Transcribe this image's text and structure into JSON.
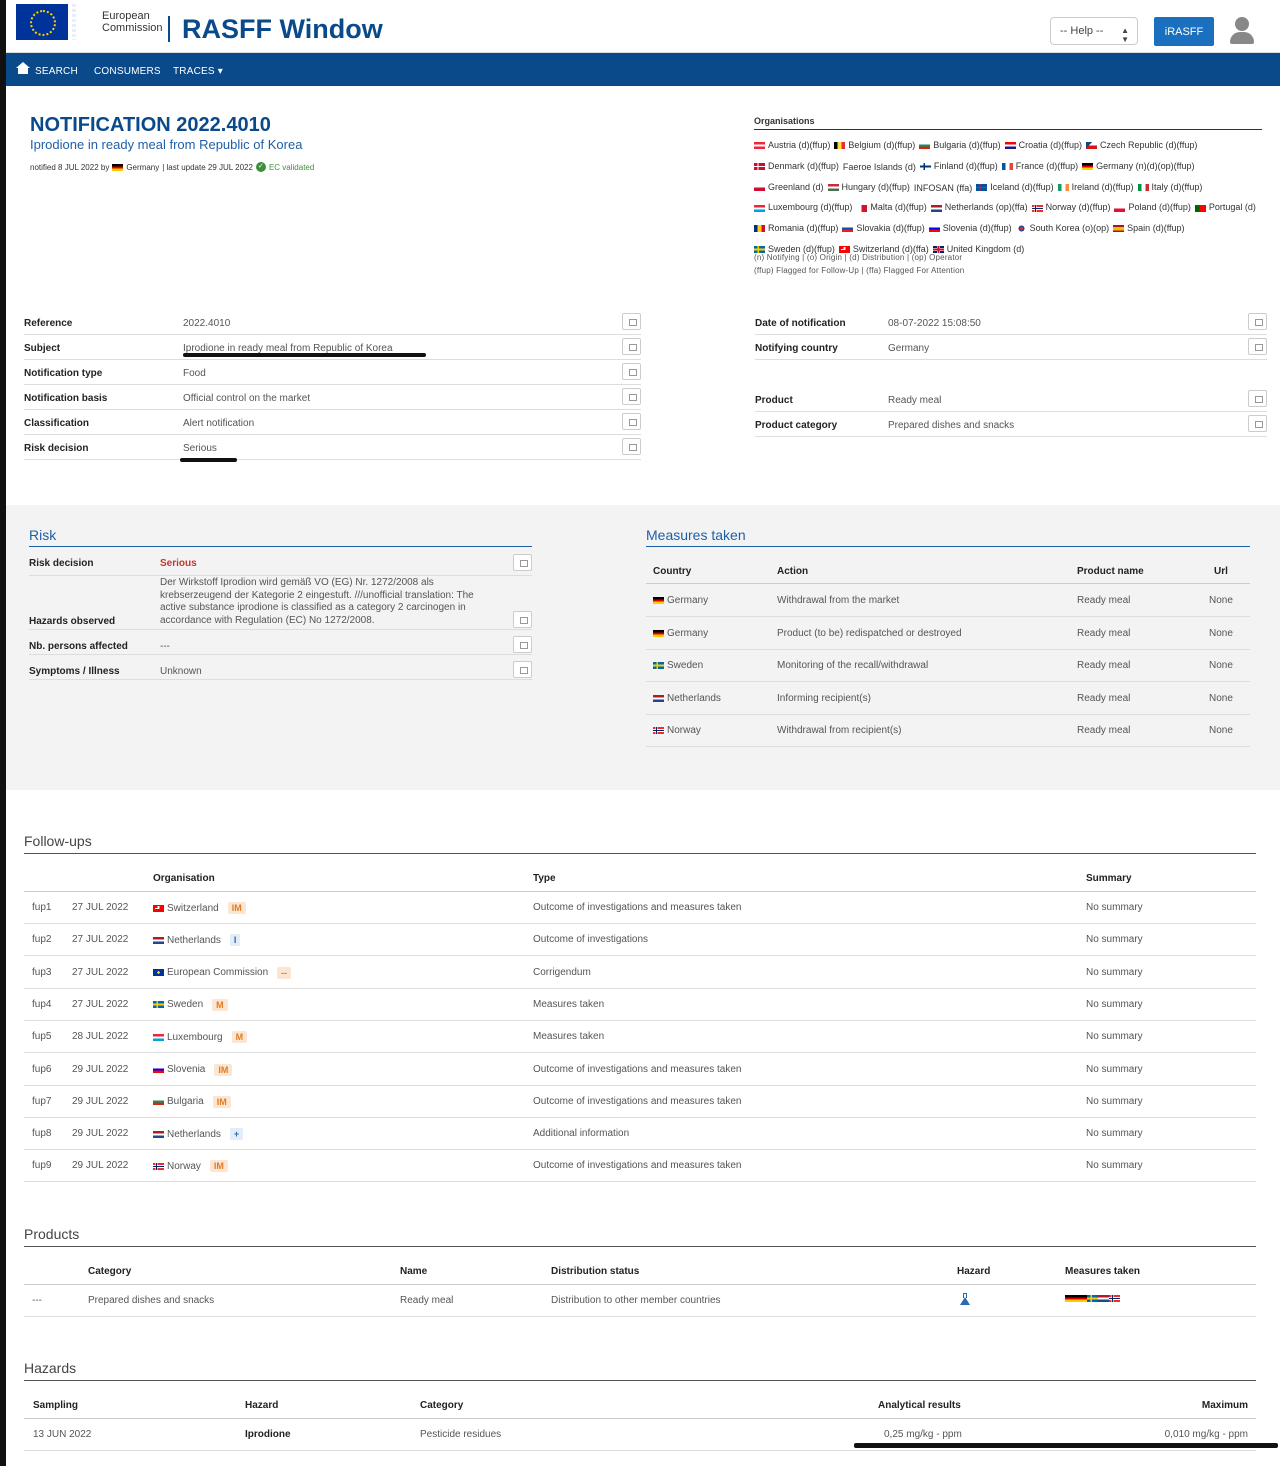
{
  "header": {
    "org_name_line1": "European",
    "org_name_line2": "Commission",
    "app_title": "RASFF Window",
    "help_select": "-- Help --",
    "irasff_button": "iRASFF"
  },
  "nav": {
    "search": "SEARCH",
    "consumers": "CONSUMERS",
    "traces": "TRACES ▾"
  },
  "notification": {
    "title": "NOTIFICATION 2022.4010",
    "subtitle": "Iprodione in ready meal from Republic of Korea",
    "meta_prefix": "notified 8 JUL 2022 by",
    "meta_country": "Germany",
    "meta_update": "| last update 29 JUL 2022",
    "validated": "EC validated"
  },
  "organisations": {
    "title": "Organisations",
    "items": [
      {
        "name": "Austria (d)(ffup)",
        "flag": "at"
      },
      {
        "name": "Belgium (d)(ffup)",
        "flag": "be"
      },
      {
        "name": "Bulgaria (d)(ffup)",
        "flag": "bg"
      },
      {
        "name": "Croatia (d)(ffup)",
        "flag": "hr"
      },
      {
        "name": "Czech Republic (d)(ffup)",
        "flag": "cz"
      },
      {
        "name": "Denmark (d)(ffup)",
        "flag": "dk"
      },
      {
        "name": "Faeroe Islands (d)",
        "flag": ""
      },
      {
        "name": "Finland (d)(ffup)",
        "flag": "fi"
      },
      {
        "name": "France (d)(ffup)",
        "flag": "fr"
      },
      {
        "name": "Germany (n)(d)(op)(ffup)",
        "flag": "de"
      },
      {
        "name": "Greenland (d)",
        "flag": "gl"
      },
      {
        "name": "Hungary (d)(ffup)",
        "flag": "hu"
      },
      {
        "name": "INFOSAN (ffa)",
        "flag": ""
      },
      {
        "name": "Iceland (d)(ffup)",
        "flag": "is"
      },
      {
        "name": "Ireland (d)(ffup)",
        "flag": "ie"
      },
      {
        "name": "Italy (d)(ffup)",
        "flag": "it"
      },
      {
        "name": "Luxembourg (d)(ffup)",
        "flag": "lu"
      },
      {
        "name": "Malta (d)(ffup)",
        "flag": "mt"
      },
      {
        "name": "Netherlands (op)(ffa)",
        "flag": "nl"
      },
      {
        "name": "Norway (d)(ffup)",
        "flag": "no"
      },
      {
        "name": "Poland (d)(ffup)",
        "flag": "pl"
      },
      {
        "name": "Portugal (d)",
        "flag": "pt"
      },
      {
        "name": "Romania (d)(ffup)",
        "flag": "ro"
      },
      {
        "name": "Slovakia (d)(ffup)",
        "flag": "sk"
      },
      {
        "name": "Slovenia (d)(ffup)",
        "flag": "si"
      },
      {
        "name": "South Korea (o)(op)",
        "flag": "kr"
      },
      {
        "name": "Spain (d)(ffup)",
        "flag": "es"
      },
      {
        "name": "Sweden (d)(ffup)",
        "flag": "se"
      },
      {
        "name": "Switzerland (d)(ffa)",
        "flag": "ch"
      },
      {
        "name": "United Kingdom (d)",
        "flag": "gb"
      }
    ],
    "legend_line1": "(n) Notifying | (o) Origin | (d) Distribution | (op) Operator",
    "legend_line2": "(ffup) Flagged for Follow-Up | (ffa) Flagged For Attention"
  },
  "details_left": [
    {
      "label": "Reference",
      "value": "2022.4010"
    },
    {
      "label": "Subject",
      "value": "Iprodione in ready meal from Republic of Korea"
    },
    {
      "label": "Notification type",
      "value": "Food"
    },
    {
      "label": "Notification basis",
      "value": "Official control on the market"
    },
    {
      "label": "Classification",
      "value": "Alert notification"
    },
    {
      "label": "Risk decision",
      "value": "Serious"
    }
  ],
  "details_right": [
    {
      "label": "Date of notification",
      "value": "08-07-2022 15:08:50"
    },
    {
      "label": "Notifying country",
      "value": "Germany"
    },
    {
      "label": "Product",
      "value": "Ready meal"
    },
    {
      "label": "Product category",
      "value": "Prepared dishes and snacks"
    }
  ],
  "risk": {
    "title": "Risk",
    "decision_label": "Risk decision",
    "decision_value": "Serious",
    "hazards_label": "Hazards observed",
    "hazards_value": "Der Wirkstoff Iprodion wird gemäß VO (EG) Nr. 1272/2008 als krebserzeugend der Kategorie 2 eingestuft. ///unofficial translation: The active substance iprodione is classified as a category 2 carcinogen in accordance with Regulation (EC) No 1272/2008.",
    "persons_label": "Nb. persons affected",
    "persons_value": "---",
    "symptoms_label": "Symptoms / Illness",
    "symptoms_value": "Unknown"
  },
  "measures": {
    "title": "Measures taken",
    "headers": {
      "country": "Country",
      "action": "Action",
      "product": "Product name",
      "url": "Url"
    },
    "rows": [
      {
        "country": "Germany",
        "flag": "de",
        "action": "Withdrawal from the market",
        "product": "Ready meal",
        "url": "None"
      },
      {
        "country": "Germany",
        "flag": "de",
        "action": "Product (to be) redispatched or destroyed",
        "product": "Ready meal",
        "url": "None"
      },
      {
        "country": "Sweden",
        "flag": "se",
        "action": "Monitoring of the recall/withdrawal",
        "product": "Ready meal",
        "url": "None"
      },
      {
        "country": "Netherlands",
        "flag": "nl",
        "action": "Informing recipient(s)",
        "product": "Ready meal",
        "url": "None"
      },
      {
        "country": "Norway",
        "flag": "no",
        "action": "Withdrawal from recipient(s)",
        "product": "Ready meal",
        "url": "None"
      }
    ]
  },
  "followups": {
    "title": "Follow-ups",
    "headers": {
      "organisation": "Organisation",
      "type": "Type",
      "summary": "Summary"
    },
    "rows": [
      {
        "id": "fup1",
        "date": "27 JUL 2022",
        "org": "Switzerland",
        "flag": "ch",
        "badge": "IM",
        "badge_type": "im",
        "type": "Outcome of investigations and measures taken",
        "summary": "No summary"
      },
      {
        "id": "fup2",
        "date": "27 JUL 2022",
        "org": "Netherlands",
        "flag": "nl",
        "badge": "I",
        "badge_type": "i",
        "type": "Outcome of investigations",
        "summary": "No summary"
      },
      {
        "id": "fup3",
        "date": "27 JUL 2022",
        "org": "European Commission",
        "flag": "eu",
        "badge": "--",
        "badge_type": "dash",
        "type": "Corrigendum",
        "summary": "No summary"
      },
      {
        "id": "fup4",
        "date": "27 JUL 2022",
        "org": "Sweden",
        "flag": "se",
        "badge": "M",
        "badge_type": "m",
        "type": "Measures taken",
        "summary": "No summary"
      },
      {
        "id": "fup5",
        "date": "28 JUL 2022",
        "org": "Luxembourg",
        "flag": "lu",
        "badge": "M",
        "badge_type": "m",
        "type": "Measures taken",
        "summary": "No summary"
      },
      {
        "id": "fup6",
        "date": "29 JUL 2022",
        "org": "Slovenia",
        "flag": "si",
        "badge": "IM",
        "badge_type": "im",
        "type": "Outcome of investigations and measures taken",
        "summary": "No summary"
      },
      {
        "id": "fup7",
        "date": "29 JUL 2022",
        "org": "Bulgaria",
        "flag": "bg",
        "badge": "IM",
        "badge_type": "im",
        "type": "Outcome of investigations and measures taken",
        "summary": "No summary"
      },
      {
        "id": "fup8",
        "date": "29 JUL 2022",
        "org": "Netherlands",
        "flag": "nl",
        "badge": "+",
        "badge_type": "plus",
        "type": "Additional information",
        "summary": "No summary"
      },
      {
        "id": "fup9",
        "date": "29 JUL 2022",
        "org": "Norway",
        "flag": "no",
        "badge": "IM",
        "badge_type": "im",
        "type": "Outcome of investigations and measures taken",
        "summary": "No summary"
      }
    ]
  },
  "products": {
    "title": "Products",
    "headers": {
      "category": "Category",
      "name": "Name",
      "distribution": "Distribution status",
      "hazard": "Hazard",
      "measures": "Measures taken"
    },
    "rows": [
      {
        "id": "---",
        "category": "Prepared dishes and snacks",
        "name": "Ready meal",
        "distribution": "Distribution to other member countries",
        "hazard_icon": "flask-icon",
        "measure_flags": [
          "de",
          "de",
          "se",
          "nl",
          "no"
        ]
      }
    ]
  },
  "hazards": {
    "title": "Hazards",
    "headers": {
      "sampling": "Sampling",
      "hazard": "Hazard",
      "category": "Category",
      "results": "Analytical results",
      "maximum": "Maximum"
    },
    "rows": [
      {
        "sampling": "13 JUN 2022",
        "hazard": "Iprodione",
        "category": "Pesticide residues",
        "results": "0,25 mg/kg - ppm",
        "maximum": "0,010 mg/kg - ppm"
      }
    ]
  }
}
